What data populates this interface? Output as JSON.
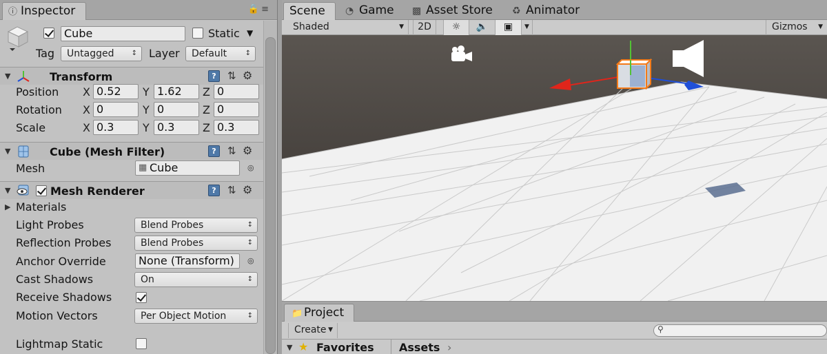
{
  "inspector": {
    "tab_label": "Inspector",
    "object": {
      "active": true,
      "name": "Cube",
      "static_label": "Static",
      "static": false,
      "tag_label": "Tag",
      "tag_value": "Untagged",
      "layer_label": "Layer",
      "layer_value": "Default"
    },
    "transform": {
      "title": "Transform",
      "position": {
        "label": "Position",
        "x": "0.52",
        "y": "1.62",
        "z": "0"
      },
      "rotation": {
        "label": "Rotation",
        "x": "0",
        "y": "0",
        "z": "0"
      },
      "scale": {
        "label": "Scale",
        "x": "0.3",
        "y": "0.3",
        "z": "0.3"
      },
      "axis_x": "X",
      "axis_y": "Y",
      "axis_z": "Z"
    },
    "mesh_filter": {
      "title": "Cube (Mesh Filter)",
      "mesh_label": "Mesh",
      "mesh_value": "Cube"
    },
    "mesh_renderer": {
      "title": "Mesh Renderer",
      "enabled": true,
      "materials_label": "Materials",
      "light_probes_label": "Light Probes",
      "light_probes_value": "Blend Probes",
      "reflection_probes_label": "Reflection Probes",
      "reflection_probes_value": "Blend Probes",
      "anchor_override_label": "Anchor Override",
      "anchor_override_value": "None (Transform)",
      "cast_shadows_label": "Cast Shadows",
      "cast_shadows_value": "On",
      "receive_shadows_label": "Receive Shadows",
      "receive_shadows": true,
      "motion_vectors_label": "Motion Vectors",
      "motion_vectors_value": "Per Object Motion",
      "lightmap_static_label": "Lightmap Static",
      "lightmap_static": false
    }
  },
  "scene_tabs": {
    "scene": "Scene",
    "game": "Game",
    "asset_store": "Asset Store",
    "animator": "Animator"
  },
  "scene_toolbar": {
    "draw_mode": "Shaded",
    "mode_2d": "2D",
    "gizmos": "Gizmos"
  },
  "project": {
    "tab_label": "Project",
    "create_label": "Create",
    "favorites_label": "Favorites",
    "assets_label": "Assets"
  },
  "colors": {
    "selection_outline": "#f47a18",
    "axis_x": "#e0251b",
    "axis_y": "#52c234",
    "axis_z": "#1f4fd8",
    "sky": "#4c4743",
    "ground": "#f2f2f2"
  }
}
